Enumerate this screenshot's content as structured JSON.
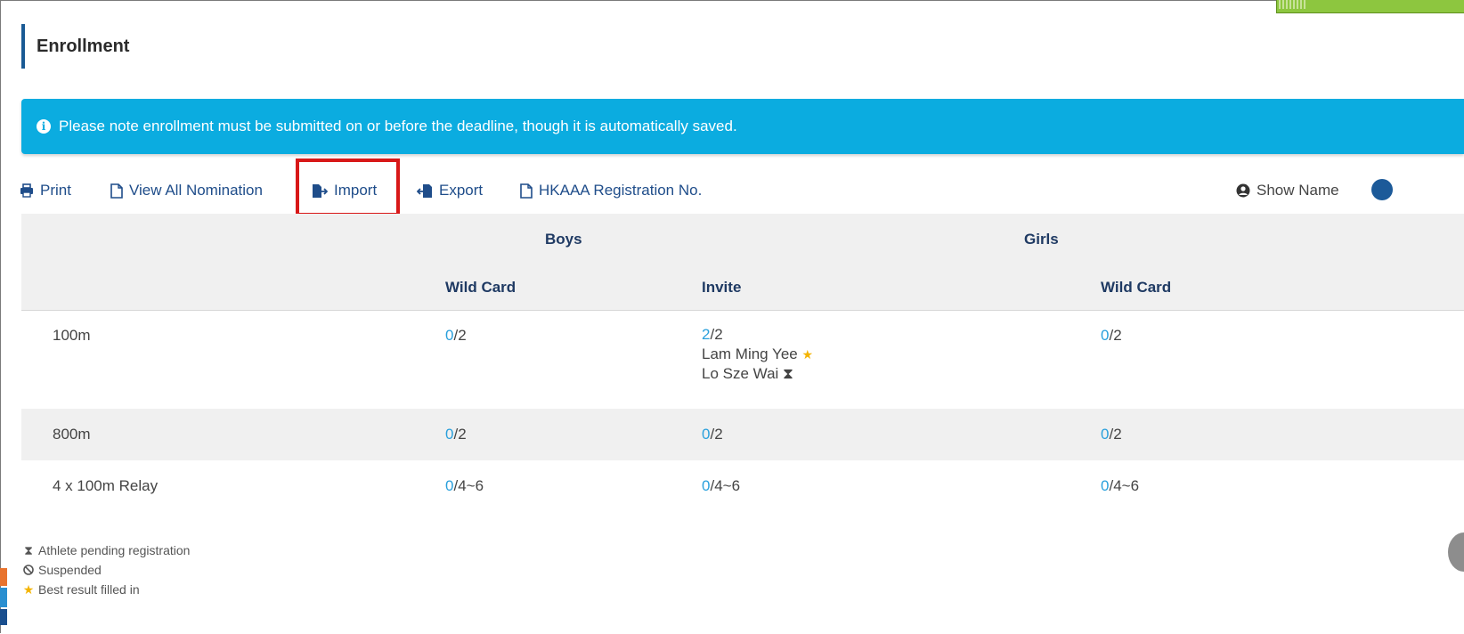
{
  "title": "Enrollment",
  "notice": {
    "icon": "info-circle-icon",
    "text": "Please note enrollment must be submitted on or before the deadline, though it is automatically saved."
  },
  "toolbar": {
    "print": "Print",
    "view_all": "View All Nomination",
    "import": "Import",
    "export": "Export",
    "registration": "HKAAA Registration No.",
    "show_name": "Show Name"
  },
  "table": {
    "groups": {
      "boys": "Boys",
      "girls": "Girls"
    },
    "subheaders": {
      "boys_wild": "Wild Card",
      "boys_invite": "Invite",
      "girls_wild": "Wild Card"
    },
    "rows": [
      {
        "event": "100m",
        "boys_wild": {
          "count": "0",
          "limit": "/2"
        },
        "boys_invite": {
          "count": "2",
          "limit": "/2",
          "names": [
            "Lam Ming Yee",
            "Lo Sze Wai"
          ]
        },
        "girls_wild": {
          "count": "0",
          "limit": "/2"
        }
      },
      {
        "event": "800m",
        "boys_wild": {
          "count": "0",
          "limit": "/2"
        },
        "boys_invite": {
          "count": "0",
          "limit": "/2"
        },
        "girls_wild": {
          "count": "0",
          "limit": "/2"
        }
      },
      {
        "event": "4 x 100m Relay",
        "boys_wild": {
          "count": "0",
          "limit": "/4~6"
        },
        "boys_invite": {
          "count": "0",
          "limit": "/4~6"
        },
        "girls_wild": {
          "count": "0",
          "limit": "/4~6"
        }
      }
    ]
  },
  "legend": {
    "pending": "Athlete pending registration",
    "suspended": "Suspended",
    "best_result": "Best result filled in"
  },
  "colors": {
    "accent": "#1f4d8a",
    "notice_bg": "#0bace0",
    "count_blue": "#2aa0dc",
    "highlight_red": "#d81818",
    "star": "#f4b400"
  }
}
